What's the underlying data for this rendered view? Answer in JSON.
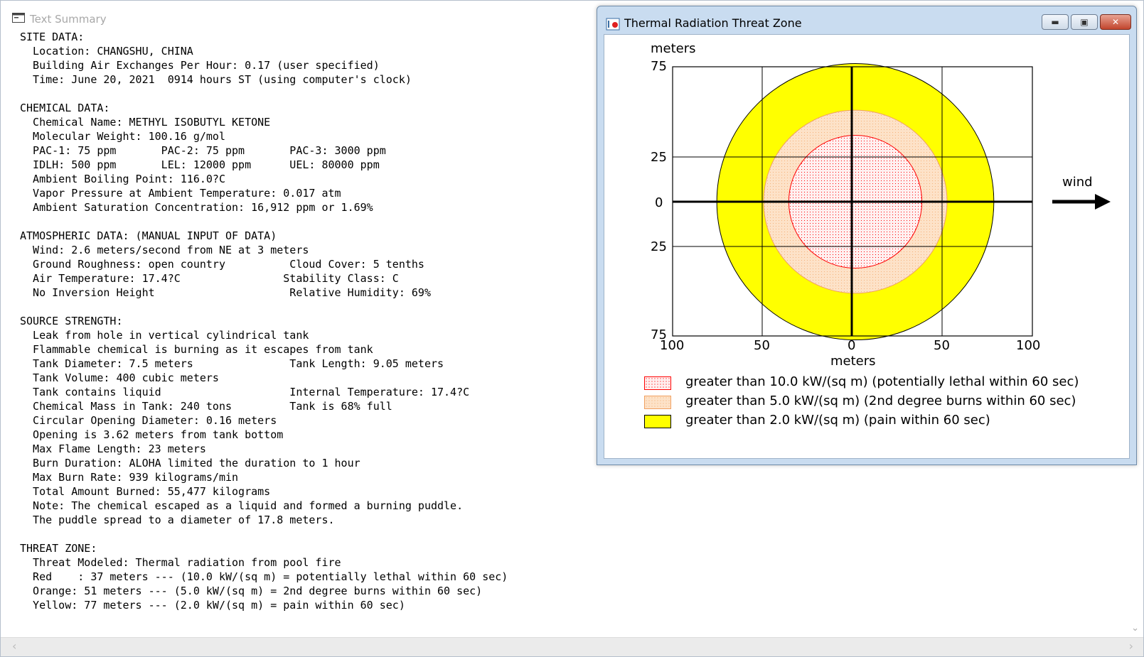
{
  "summary": {
    "title": "Text Summary",
    "text": "SITE DATA:\n  Location: CHANGSHU, CHINA\n  Building Air Exchanges Per Hour: 0.17 (user specified)\n  Time: June 20, 2021  0914 hours ST (using computer's clock)\n\nCHEMICAL DATA:\n  Chemical Name: METHYL ISOBUTYL KETONE\n  Molecular Weight: 100.16 g/mol\n  PAC-1: 75 ppm       PAC-2: 75 ppm       PAC-3: 3000 ppm\n  IDLH: 500 ppm       LEL: 12000 ppm      UEL: 80000 ppm\n  Ambient Boiling Point: 116.0?C\n  Vapor Pressure at Ambient Temperature: 0.017 atm\n  Ambient Saturation Concentration: 16,912 ppm or 1.69%\n\nATMOSPHERIC DATA: (MANUAL INPUT OF DATA)\n  Wind: 2.6 meters/second from NE at 3 meters\n  Ground Roughness: open country          Cloud Cover: 5 tenths\n  Air Temperature: 17.4?C                Stability Class: C\n  No Inversion Height                     Relative Humidity: 69%\n\nSOURCE STRENGTH:\n  Leak from hole in vertical cylindrical tank\n  Flammable chemical is burning as it escapes from tank\n  Tank Diameter: 7.5 meters               Tank Length: 9.05 meters\n  Tank Volume: 400 cubic meters\n  Tank contains liquid                    Internal Temperature: 17.4?C\n  Chemical Mass in Tank: 240 tons         Tank is 68% full\n  Circular Opening Diameter: 0.16 meters\n  Opening is 3.62 meters from tank bottom\n  Max Flame Length: 23 meters\n  Burn Duration: ALOHA limited the duration to 1 hour\n  Max Burn Rate: 939 kilograms/min\n  Total Amount Burned: 55,477 kilograms\n  Note: The chemical escaped as a liquid and formed a burning puddle.\n  The puddle spread to a diameter of 17.8 meters.\n\nTHREAT ZONE:\n  Threat Modeled: Thermal radiation from pool fire\n  Red    : 37 meters --- (10.0 kW/(sq m) = potentially lethal within 60 sec)\n  Orange: 51 meters --- (5.0 kW/(sq m) = 2nd degree burns within 60 sec)\n  Yellow: 77 meters --- (2.0 kW/(sq m) = pain within 60 sec)"
  },
  "threat_window": {
    "title": "Thermal Radiation Threat Zone",
    "y_axis_label": "meters",
    "x_axis_label": "meters",
    "wind_label": "wind",
    "y_ticks": [
      "75",
      "25",
      "0",
      "25",
      "75"
    ],
    "x_ticks": [
      "100",
      "50",
      "0",
      "50",
      "100"
    ],
    "zones": [
      {
        "label": "greater than 10.0 kW/(sq m) (potentially lethal within 60 sec)",
        "color": "#ff0000",
        "radius_m": 37
      },
      {
        "label": "greater than 5.0 kW/(sq m) (2nd degree burns within 60 sec)",
        "color": "#f5b27a",
        "radius_m": 51
      },
      {
        "label": "greater than 2.0 kW/(sq m) (pain within 60 sec)",
        "color": "#ffff00",
        "radius_m": 77
      }
    ]
  }
}
